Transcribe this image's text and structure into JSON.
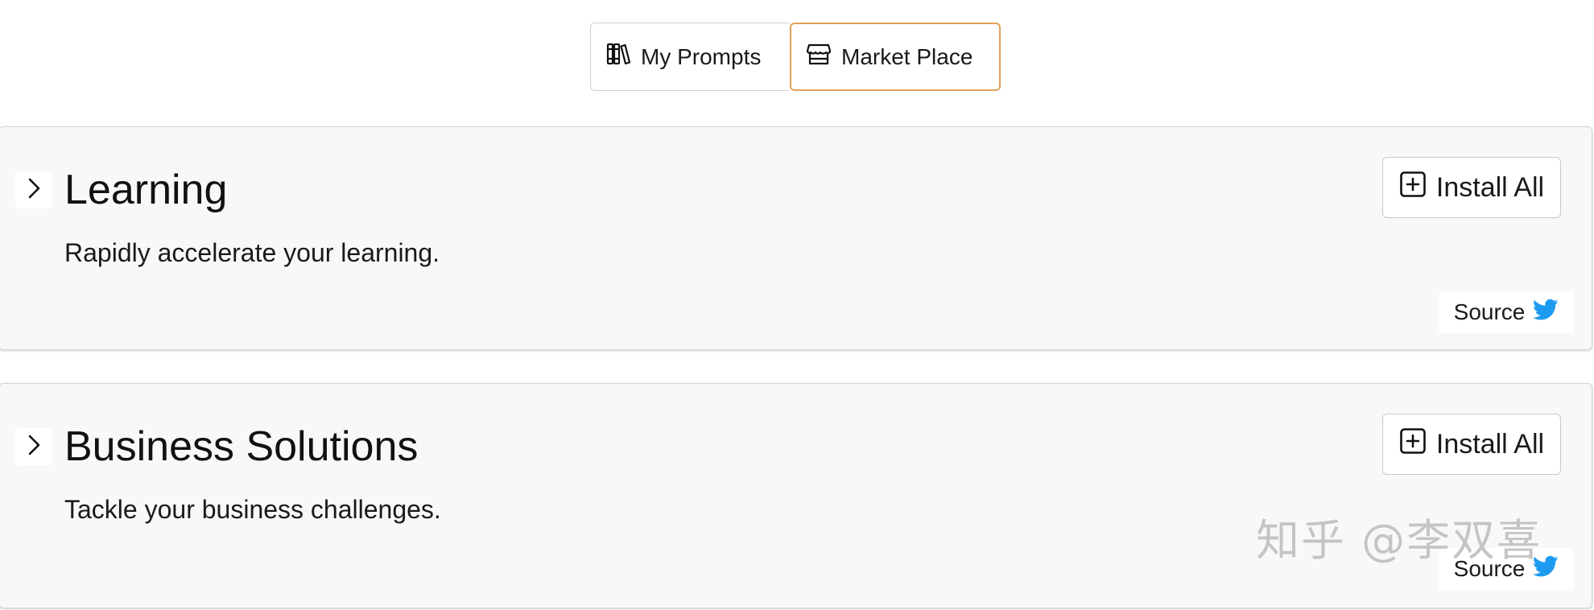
{
  "tabs": {
    "my_prompts": {
      "label": "My Prompts",
      "icon": "books-icon"
    },
    "market_place": {
      "label": "Market Place",
      "icon": "store-icon",
      "active": true
    }
  },
  "categories": [
    {
      "title": "Learning",
      "description": "Rapidly accelerate your learning.",
      "install_label": "Install All",
      "source_label": "Source"
    },
    {
      "title": "Business Solutions",
      "description": "Tackle your business challenges.",
      "install_label": "Install All",
      "source_label": "Source"
    }
  ],
  "watermark": "知乎 @李双喜",
  "colors": {
    "active_tab_border": "#e0a25a",
    "twitter_blue": "#1d9bf0",
    "card_background": "#f8f8f8"
  }
}
